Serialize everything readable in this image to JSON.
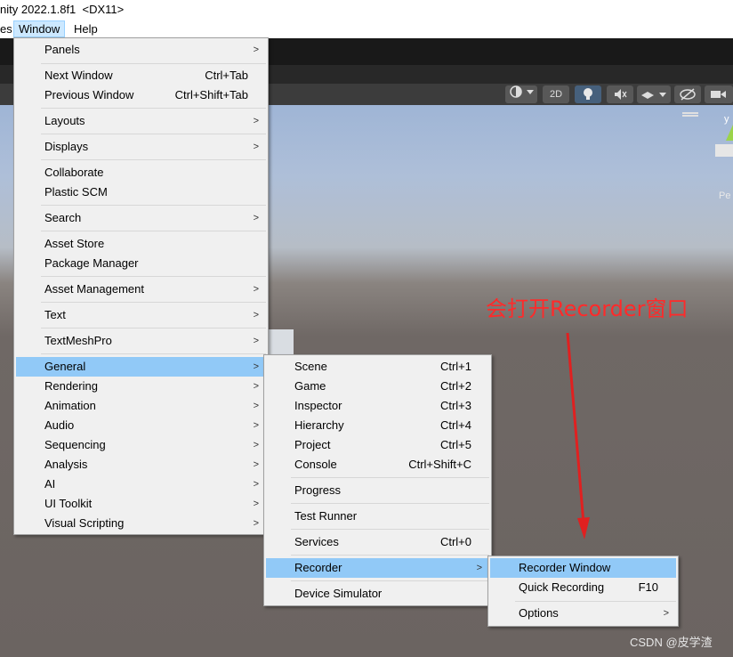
{
  "window": {
    "title": "nity 2022.1.8f1  <DX11>"
  },
  "menubar": {
    "items": [
      "es",
      "Window",
      "Help"
    ]
  },
  "toolbar": {
    "btn_2d": "2D"
  },
  "scene": {
    "gizmo_y": "y",
    "gizmo_persp": "Pe"
  },
  "window_menu": {
    "panels": "Panels",
    "next_window": "Next Window",
    "next_window_sc": "Ctrl+Tab",
    "previous_window": "Previous Window",
    "previous_window_sc": "Ctrl+Shift+Tab",
    "layouts": "Layouts",
    "displays": "Displays",
    "collaborate": "Collaborate",
    "plastic_scm": "Plastic SCM",
    "search": "Search",
    "asset_store": "Asset Store",
    "package_manager": "Package Manager",
    "asset_management": "Asset Management",
    "text": "Text",
    "textmeshpro": "TextMeshPro",
    "general": "General",
    "rendering": "Rendering",
    "animation": "Animation",
    "audio": "Audio",
    "sequencing": "Sequencing",
    "analysis": "Analysis",
    "ai": "AI",
    "ui_toolkit": "UI Toolkit",
    "visual_scripting": "Visual Scripting"
  },
  "general_menu": {
    "scene": "Scene",
    "scene_sc": "Ctrl+1",
    "game": "Game",
    "game_sc": "Ctrl+2",
    "inspector": "Inspector",
    "inspector_sc": "Ctrl+3",
    "hierarchy": "Hierarchy",
    "hierarchy_sc": "Ctrl+4",
    "project": "Project",
    "project_sc": "Ctrl+5",
    "console": "Console",
    "console_sc": "Ctrl+Shift+C",
    "progress": "Progress",
    "test_runner": "Test Runner",
    "services": "Services",
    "services_sc": "Ctrl+0",
    "recorder": "Recorder",
    "device_simulator": "Device Simulator"
  },
  "recorder_menu": {
    "recorder_window": "Recorder Window",
    "quick_recording": "Quick Recording",
    "quick_recording_sc": "F10",
    "options": "Options"
  },
  "annotation": {
    "text": "会打开Recorder窗口",
    "color": "#ff2a2a"
  },
  "watermark": {
    "text": "CSDN @皮学渣"
  },
  "colors": {
    "menu_bg": "#f0f0f0",
    "highlight": "#91c9f7",
    "menubar_active": "#cce8ff"
  }
}
